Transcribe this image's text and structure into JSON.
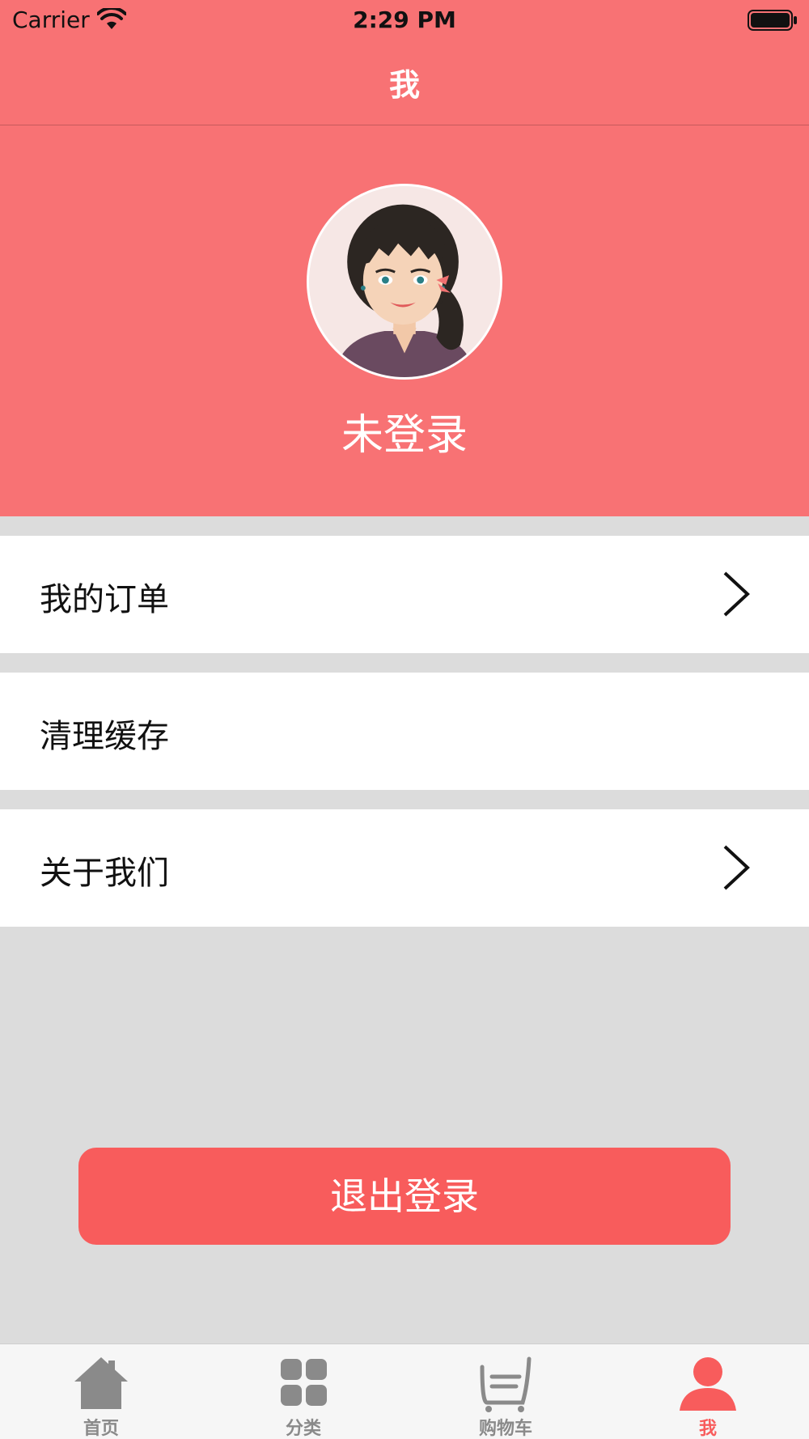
{
  "status_bar": {
    "carrier": "Carrier",
    "time": "2:29 PM",
    "wifi_icon": "wifi-icon",
    "battery_icon": "battery-full-icon"
  },
  "nav": {
    "title": "我"
  },
  "profile": {
    "avatar_icon": "avatar-girl-illustration",
    "username": "未登录",
    "background_color": "#f87274"
  },
  "menu": [
    {
      "label": "我的订单",
      "has_chevron": true,
      "icon": "chevron-right-icon"
    },
    {
      "label": "清理缓存",
      "has_chevron": false
    },
    {
      "label": "关于我们",
      "has_chevron": true,
      "icon": "chevron-right-icon"
    }
  ],
  "logout_button": {
    "label": "退出登录",
    "color": "#f85c5c"
  },
  "tab_bar": {
    "tabs": [
      {
        "label": "首页",
        "icon": "home-icon",
        "active": false
      },
      {
        "label": "分类",
        "icon": "grid-icon",
        "active": false
      },
      {
        "label": "购物车",
        "icon": "cart-icon",
        "active": false
      },
      {
        "label": "我",
        "icon": "user-icon",
        "active": true
      }
    ],
    "active_color": "#f85c5c",
    "inactive_color": "#8a8a8a"
  }
}
